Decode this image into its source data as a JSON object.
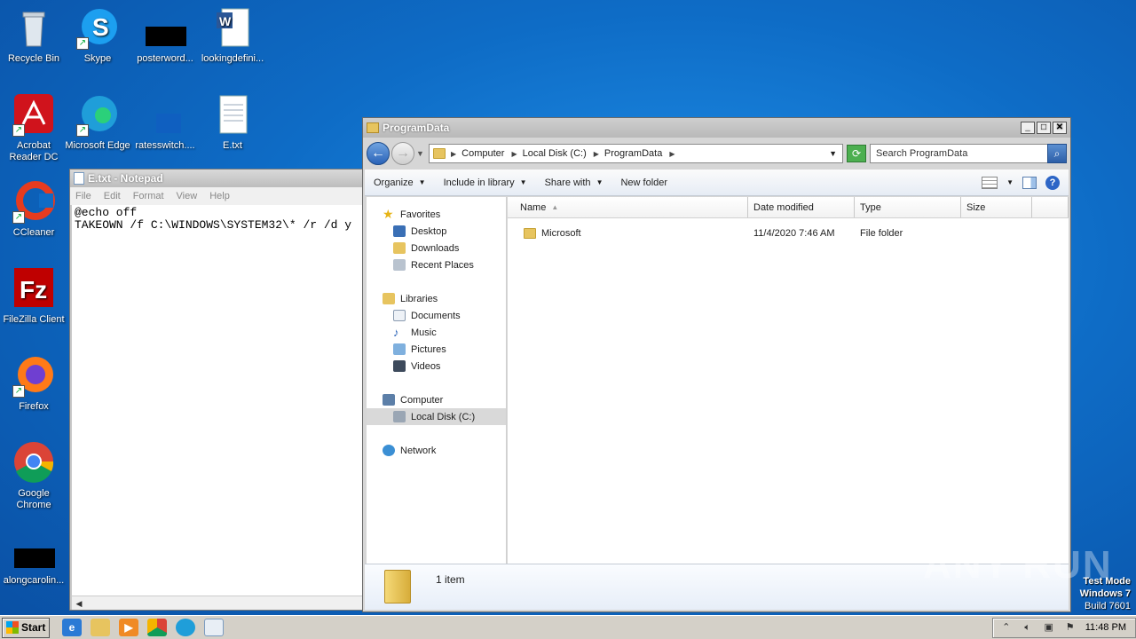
{
  "desktop": {
    "icons": [
      {
        "label": "Recycle Bin",
        "icon": "recycle-bin-icon"
      },
      {
        "label": "Skype",
        "icon": "skype-icon"
      },
      {
        "label": "posterword...",
        "icon": "redacted-file-icon"
      },
      {
        "label": "lookingdefini...",
        "icon": "word-document-icon"
      },
      {
        "label": "Acrobat Reader DC",
        "icon": "acrobat-icon"
      },
      {
        "label": "Microsoft Edge",
        "icon": "edge-icon"
      },
      {
        "label": "ratesswitch....",
        "icon": "blue-file-icon"
      },
      {
        "label": "E.txt",
        "icon": "text-file-icon"
      },
      {
        "label": "CCleaner",
        "icon": "ccleaner-icon"
      },
      {
        "label": "FileZilla Client",
        "icon": "filezilla-icon"
      },
      {
        "label": "Firefox",
        "icon": "firefox-icon"
      },
      {
        "label": "Google Chrome",
        "icon": "chrome-icon"
      },
      {
        "label": "alongcarolin...",
        "icon": "redacted-file-icon"
      }
    ]
  },
  "notepad": {
    "title": "E.txt - Notepad",
    "menu": [
      "File",
      "Edit",
      "Format",
      "View",
      "Help"
    ],
    "content": "@echo off\nTAKEOWN /f C:\\WINDOWS\\SYSTEM32\\* /r /d y"
  },
  "explorer": {
    "title": "ProgramData",
    "breadcrumb": [
      "Computer",
      "Local Disk (C:)",
      "ProgramData"
    ],
    "search_placeholder": "Search ProgramData",
    "commands": [
      "Organize",
      "Include in library",
      "Share with",
      "New folder"
    ],
    "nav": {
      "favorites": {
        "label": "Favorites",
        "items": [
          "Desktop",
          "Downloads",
          "Recent Places"
        ]
      },
      "libraries": {
        "label": "Libraries",
        "items": [
          "Documents",
          "Music",
          "Pictures",
          "Videos"
        ]
      },
      "computer": {
        "label": "Computer",
        "items": [
          "Local Disk (C:)"
        ]
      },
      "network": {
        "label": "Network"
      }
    },
    "columns": [
      "Name",
      "Date modified",
      "Type",
      "Size"
    ],
    "files": [
      {
        "name": "Microsoft",
        "date": "11/4/2020 7:46 AM",
        "type": "File folder",
        "size": ""
      }
    ],
    "status": "1 item"
  },
  "watermark": "ANY RUN",
  "system": {
    "test_mode": "Test Mode",
    "os": "Windows 7",
    "build": "Build 7601"
  },
  "taskbar": {
    "start_label": "Start",
    "clock": "11:48 PM"
  }
}
